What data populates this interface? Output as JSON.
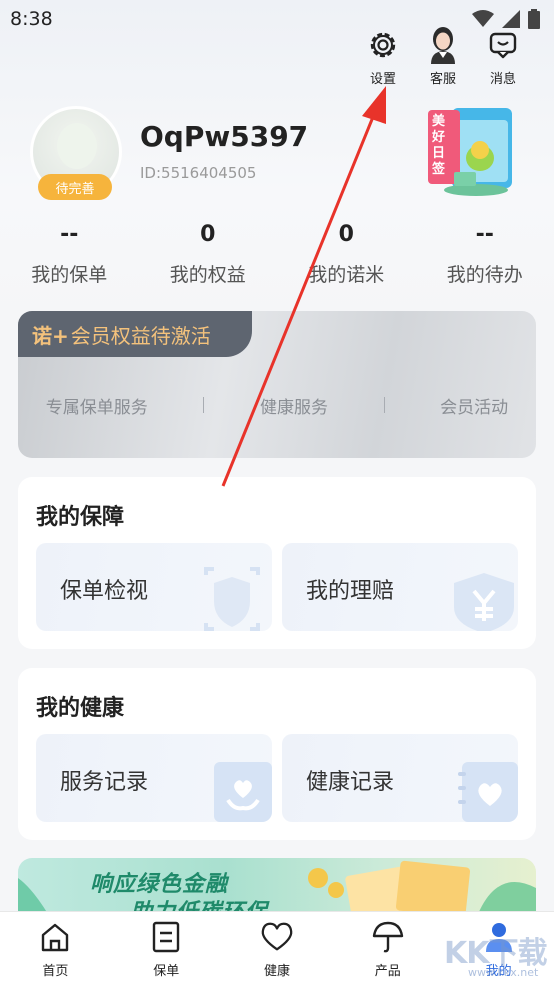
{
  "status_bar": {
    "time": "8:38"
  },
  "header_actions": [
    {
      "label": "设置",
      "icon": "gear-icon"
    },
    {
      "label": "客服",
      "icon": "agent-avatar-icon"
    },
    {
      "label": "消息",
      "icon": "message-icon"
    }
  ],
  "profile": {
    "username": "OqPw5397",
    "user_id": "ID:5516404505",
    "badge": "待完善",
    "sign_card_text": "美好日签"
  },
  "stats": [
    {
      "value": "--",
      "label": "我的保单"
    },
    {
      "value": "0",
      "label": "我的权益"
    },
    {
      "value": "0",
      "label": "我的诺米"
    },
    {
      "value": "--",
      "label": "我的待办"
    }
  ],
  "member_card": {
    "logo": "诺+",
    "title": "会员权益待激活",
    "tabs": [
      "专属保单服务",
      "健康服务",
      "会员活动"
    ]
  },
  "protection": {
    "title": "我的保障",
    "items": [
      "保单检视",
      "我的理赔"
    ]
  },
  "health": {
    "title": "我的健康",
    "items": [
      "服务记录",
      "健康记录"
    ]
  },
  "banner": {
    "line1": "响应绿色金融",
    "line2": "助力低碳环保"
  },
  "tabbar": [
    {
      "label": "首页",
      "icon": "home-icon"
    },
    {
      "label": "保单",
      "icon": "policy-icon"
    },
    {
      "label": "健康",
      "icon": "heart-icon"
    },
    {
      "label": "产品",
      "icon": "umbrella-icon"
    },
    {
      "label": "我的",
      "icon": "person-icon",
      "active": true
    }
  ],
  "watermark": {
    "text": "KK下载",
    "sub": "www.kkx.net"
  },
  "colors": {
    "accent": "#2f6bde",
    "badge": "#f6b43c",
    "member_gold": "#f4c27c",
    "annotation_arrow": "#e8332a"
  }
}
